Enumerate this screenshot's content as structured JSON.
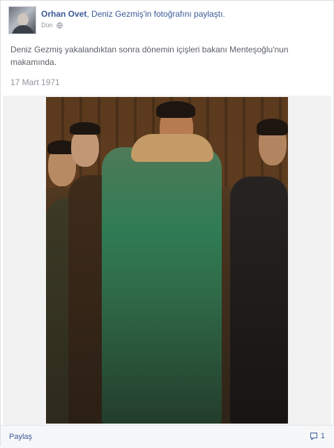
{
  "post": {
    "author": "Orhan Ovet",
    "action": ", Deniz Gezmiş'in fotoğrafını paylaştı.",
    "time": "Dün",
    "text": "Deniz Gezmiş yakalandıktan sonra dönemin içişleri bakanı Menteşoğlu'nun makamında.",
    "date": "17 Mart 1971",
    "share_label": "Paylaş",
    "comment_count": "1"
  },
  "colors": {
    "link": "#3b5998",
    "muted": "#90949c",
    "text": "#5a5f66"
  },
  "icons": {
    "privacy": "globe-icon",
    "comments": "comment-icon"
  }
}
